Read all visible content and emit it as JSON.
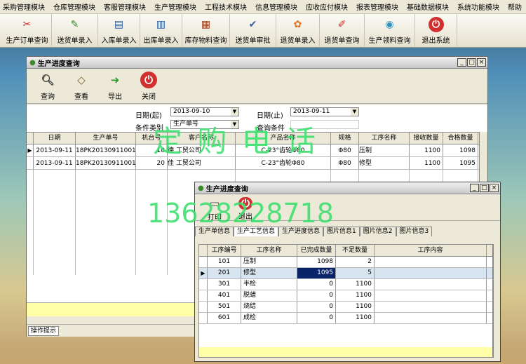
{
  "menu": [
    "采购管理模块",
    "仓库管理模块",
    "客服管理模块",
    "生产管理模块",
    "工程技术模块",
    "信息管理模块",
    "应收应付模块",
    "报表管理模块",
    "基础数据模块",
    "系统功能模块",
    "帮助"
  ],
  "toolbar": [
    {
      "label": "生产订单查询",
      "icon": "pdf-icon"
    },
    {
      "label": "送货单录入",
      "icon": "note-icon"
    },
    {
      "label": "入库单录入",
      "icon": "inbox-icon"
    },
    {
      "label": "出库单录入",
      "icon": "box-icon"
    },
    {
      "label": "库存物料查询",
      "icon": "stock-icon"
    },
    {
      "label": "送货单审批",
      "icon": "approve-icon"
    },
    {
      "label": "退货单录入",
      "icon": "flower-icon"
    },
    {
      "label": "退货单查询",
      "icon": "brush-icon"
    },
    {
      "label": "生产领料查询",
      "icon": "bag-icon"
    },
    {
      "label": "退出系统",
      "icon": "exit-icon"
    }
  ],
  "win1": {
    "title": "生产进度查询",
    "buttons": [
      "查询",
      "查看",
      "导出",
      "关闭"
    ],
    "filter": {
      "date_from_label": "日期(起)",
      "date_from": "2013-09-10",
      "date_to_label": "日期(止)",
      "date_to": "2013-09-11",
      "cond_label": "条件类别",
      "cond_value": "生产单号",
      "query_label": "查询条件"
    },
    "columns": [
      "日期",
      "生产单号",
      "机台号",
      "客户名称",
      "产品名称",
      "规格",
      "工序名称",
      "接收数量",
      "合格数量"
    ],
    "rows": [
      [
        "2013-09-11",
        "18PK20130911001",
        "10",
        "德  工贸公司",
        "C-23°齿轮Φ80",
        "Φ80",
        "压制",
        "1100",
        "1098"
      ],
      [
        "2013-09-11",
        "18PK20130911001",
        "20",
        "佳  工贸公司",
        "C-23°齿轮Φ80",
        "Φ80",
        "修型",
        "1100",
        "1095"
      ]
    ],
    "status": "操作提示"
  },
  "win2": {
    "title": "生产进度查询",
    "buttons": [
      "打印",
      "退出"
    ],
    "tabs": [
      "生产单信息",
      "生产工艺信息",
      "生产进度信息",
      "图片信息1",
      "图片信息2",
      "图片信息3"
    ],
    "columns": [
      "工序编号",
      "工序名称",
      "已完成数量",
      "不足数量",
      "工序内容"
    ],
    "rows": [
      [
        "101",
        "压制",
        "1098",
        "2",
        ""
      ],
      [
        "201",
        "修型",
        "1095",
        "5",
        ""
      ],
      [
        "301",
        "半检",
        "0",
        "1100",
        ""
      ],
      [
        "401",
        "脱蜡",
        "0",
        "1100",
        ""
      ],
      [
        "501",
        "烧结",
        "0",
        "1100",
        ""
      ],
      [
        "601",
        "成检",
        "0",
        "1100",
        ""
      ]
    ]
  },
  "watermark": {
    "text1": "定 购 电 话",
    "text2": "13628228718"
  },
  "colors": {
    "accent": "#0a246a",
    "watermark": "#3fe070",
    "highlight_row": "#ffffa8"
  }
}
